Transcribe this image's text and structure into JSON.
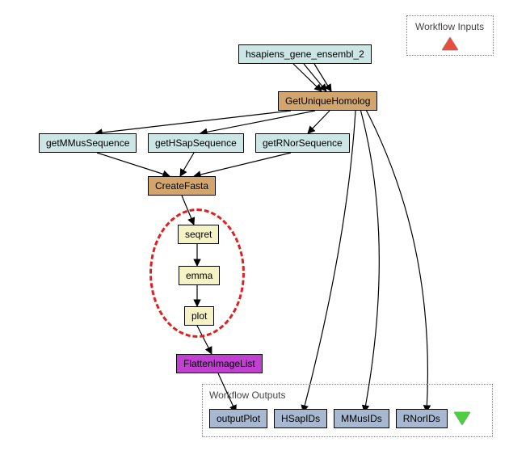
{
  "legend": {
    "inputs_title": "Workflow Inputs"
  },
  "nodes": {
    "hsapiens": "hsapiens_gene_ensembl_2",
    "getUniqueHomolog": "GetUniqueHomolog",
    "getMMus": "getMMusSequence",
    "getHSap": "getHSapSequence",
    "getRNor": "getRNorSequence",
    "createFasta": "CreateFasta",
    "seqret": "seqret",
    "emma": "emma",
    "plot": "plot",
    "flatten": "FlattenImageList"
  },
  "outputs": {
    "title": "Workflow Outputs",
    "items": [
      "outputPlot",
      "HSapIDs",
      "MMusIDs",
      "RNorIDs"
    ]
  },
  "chart_data": {
    "type": "workflow-dag",
    "title": "",
    "legend": {
      "inputs_marker": "red-triangle-up",
      "outputs_marker": "green-triangle-down"
    },
    "nodes": [
      {
        "id": "hsapiens_gene_ensembl_2",
        "label": "hsapiens_gene_ensembl_2",
        "type": "input",
        "color": "lightblue"
      },
      {
        "id": "GetUniqueHomolog",
        "label": "GetUniqueHomolog",
        "type": "processor",
        "color": "tan"
      },
      {
        "id": "getMMusSequence",
        "label": "getMMusSequence",
        "type": "processor",
        "color": "lightblue"
      },
      {
        "id": "getHSapSequence",
        "label": "getHSapSequence",
        "type": "processor",
        "color": "lightblue"
      },
      {
        "id": "getRNorSequence",
        "label": "getRNorSequence",
        "type": "processor",
        "color": "lightblue"
      },
      {
        "id": "CreateFasta",
        "label": "CreateFasta",
        "type": "processor",
        "color": "tan"
      },
      {
        "id": "seqret",
        "label": "seqret",
        "type": "processor",
        "color": "cream",
        "group": "nested"
      },
      {
        "id": "emma",
        "label": "emma",
        "type": "processor",
        "color": "cream",
        "group": "nested"
      },
      {
        "id": "plot",
        "label": "plot",
        "type": "processor",
        "color": "cream",
        "group": "nested"
      },
      {
        "id": "FlattenImageList",
        "label": "FlattenImageList",
        "type": "processor",
        "color": "purple"
      },
      {
        "id": "outputPlot",
        "label": "outputPlot",
        "type": "output",
        "color": "steelblue"
      },
      {
        "id": "HSapIDs",
        "label": "HSapIDs",
        "type": "output",
        "color": "steelblue"
      },
      {
        "id": "MMusIDs",
        "label": "MMusIDs",
        "type": "output",
        "color": "steelblue"
      },
      {
        "id": "RNorIDs",
        "label": "RNorIDs",
        "type": "output",
        "color": "steelblue"
      }
    ],
    "edges": [
      {
        "from": "hsapiens_gene_ensembl_2",
        "to": "GetUniqueHomolog"
      },
      {
        "from": "GetUniqueHomolog",
        "to": "getMMusSequence"
      },
      {
        "from": "GetUniqueHomolog",
        "to": "getHSapSequence"
      },
      {
        "from": "GetUniqueHomolog",
        "to": "getRNorSequence"
      },
      {
        "from": "GetUniqueHomolog",
        "to": "HSapIDs"
      },
      {
        "from": "GetUniqueHomolog",
        "to": "MMusIDs"
      },
      {
        "from": "GetUniqueHomolog",
        "to": "RNorIDs"
      },
      {
        "from": "getMMusSequence",
        "to": "CreateFasta"
      },
      {
        "from": "getHSapSequence",
        "to": "CreateFasta"
      },
      {
        "from": "getRNorSequence",
        "to": "CreateFasta"
      },
      {
        "from": "CreateFasta",
        "to": "seqret"
      },
      {
        "from": "seqret",
        "to": "emma"
      },
      {
        "from": "emma",
        "to": "plot"
      },
      {
        "from": "plot",
        "to": "FlattenImageList"
      },
      {
        "from": "FlattenImageList",
        "to": "outputPlot"
      }
    ],
    "groups": [
      {
        "id": "nested",
        "members": [
          "seqret",
          "emma",
          "plot"
        ],
        "outline": "red-dashed-ellipse"
      }
    ]
  }
}
